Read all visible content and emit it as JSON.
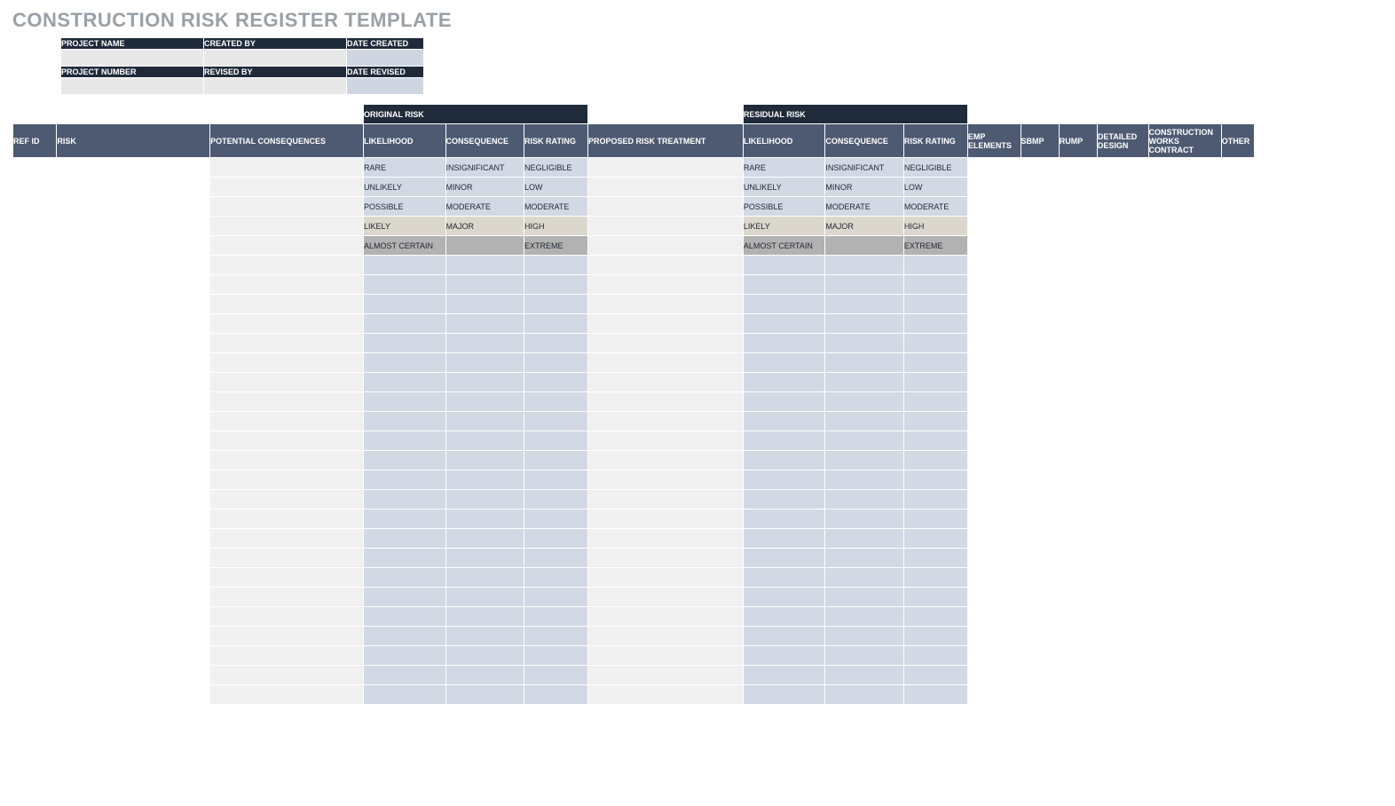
{
  "title": "CONSTRUCTION RISK REGISTER TEMPLATE",
  "meta": {
    "row1": [
      {
        "label": "PROJECT NAME",
        "value": ""
      },
      {
        "label": "CREATED BY",
        "value": ""
      },
      {
        "label": "DATE CREATED",
        "value": "",
        "alt": true
      }
    ],
    "row2": [
      {
        "label": "PROJECT NUMBER",
        "value": ""
      },
      {
        "label": "REVISED BY",
        "value": ""
      },
      {
        "label": "DATE REVISED",
        "value": "",
        "alt": true
      }
    ]
  },
  "groups": {
    "original": "ORIGINAL RISK",
    "residual": "RESIDUAL RISK"
  },
  "columns": {
    "ref": "REF ID",
    "risk": "RISK",
    "pcons": "POTENTIAL CONSEQUENCES",
    "likelihood": "LIKELIHOOD",
    "consequence": "CONSEQUENCE",
    "rating": "RISK RATING",
    "proposed": "PROPOSED RISK TREATMENT",
    "emp": "EMP ELEMENTS",
    "sbmp": "SBMP",
    "rump": "RUMP",
    "detailed": "DETAILED DESIGN",
    "cwc": "CONSTRUCTION WORKS CONTRACT",
    "other": "OTHER"
  },
  "rows": [
    {
      "likelihood": "RARE",
      "consequence": "INSIGNIFICANT",
      "rating": "NEGLIGIBLE",
      "shade": "blue"
    },
    {
      "likelihood": "UNLIKELY",
      "consequence": "MINOR",
      "rating": "LOW",
      "shade": "blue"
    },
    {
      "likelihood": "POSSIBLE",
      "consequence": "MODERATE",
      "rating": "MODERATE",
      "shade": "blue"
    },
    {
      "likelihood": "LIKELY",
      "consequence": "MAJOR",
      "rating": "HIGH",
      "shade": "beige"
    },
    {
      "likelihood": "ALMOST CERTAIN",
      "consequence": "",
      "rating": "EXTREME",
      "shade": "dgray"
    }
  ],
  "empty_rows": 23
}
